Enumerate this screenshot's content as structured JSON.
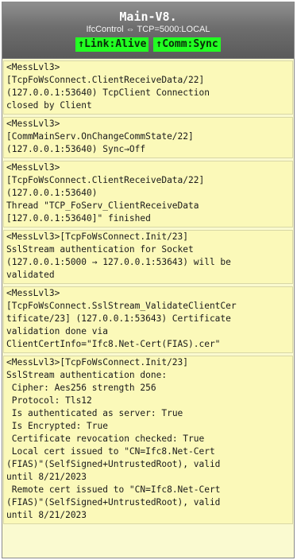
{
  "header": {
    "title": "Main-V8.",
    "subtitle": "IfcControl ⇔ TCP=5000:LOCAL",
    "link_badge": "↑Link:Alive",
    "comm_badge": "↑Comm:Sync"
  },
  "colors": {
    "badge_green": "#22ff22",
    "message_background": "#fbf9b9",
    "header_gray": "#6e6e6e"
  },
  "messages": [
    "<MessLvl3>\n[TcpFoWsConnect.ClientReceiveData/22]\n(127.0.0.1:53640) TcpClient Connection\nclosed by Client",
    "<MessLvl3>\n[CommMainServ.OnChangeCommState/22]\n(127.0.0.1:53640) Sync→Off",
    "<MessLvl3>\n[TcpFoWsConnect.ClientReceiveData/22]\n(127.0.0.1:53640)\nThread \"TCP_FoServ_ClientReceiveData\n[127.0.0.1:53640]\" finished",
    "<MessLvl3>[TcpFoWsConnect.Init/23]\nSslStream authentication for Socket\n(127.0.0.1:5000 → 127.0.0.1:53643) will be\nvalidated",
    "<MessLvl3>\n[TcpFoWsConnect.SslStream_ValidateClientCer\ntificate/23] (127.0.0.1:53643) Certificate\nvalidation done via\nClientCertInfo=\"Ifc8.Net-Cert(FIAS).cer\"",
    "<MessLvl3>[TcpFoWsConnect.Init/23]\nSslStream authentication done:\n Cipher: Aes256 strength 256\n Protocol: Tls12\n Is authenticated as server: True\n Is Encrypted: True\n Certificate revocation checked: True\n Local cert issued to \"CN=Ifc8.Net-Cert\n(FIAS)\"(SelfSigned+UntrustedRoot), valid\nuntil 8/21/2023\n Remote cert issued to \"CN=Ifc8.Net-Cert\n(FIAS)\"(SelfSigned+UntrustedRoot), valid\nuntil 8/21/2023"
  ]
}
